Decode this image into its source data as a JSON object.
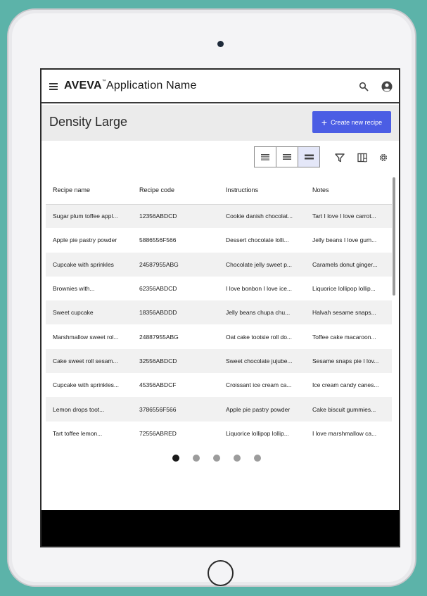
{
  "app": {
    "brand": "AVEVA",
    "trademark": "™",
    "name": "Application Name"
  },
  "page": {
    "title": "Density Large",
    "create_label": "Create new recipe"
  },
  "toolbar": {
    "density_options": [
      "compact-density-icon",
      "standard-density-icon",
      "large-density-icon"
    ],
    "selected_density": "large-density-icon",
    "tools": [
      "filter-icon",
      "columns-icon",
      "settings-icon"
    ]
  },
  "table": {
    "headers": [
      "Recipe name",
      "Recipe code",
      "Instructions",
      "Notes"
    ],
    "rows": [
      [
        "Sugar plum toffee appl...",
        "12356ABDCD",
        "Cookie danish chocolat...",
        "Tart I love I love carrot..."
      ],
      [
        "Apple pie pastry powder",
        "5886556F566",
        "Dessert chocolate lolli...",
        "Jelly beans I love gum..."
      ],
      [
        "Cupcake with sprinkles",
        "24587955ABG",
        "Chocolate jelly sweet p...",
        "Caramels donut ginger..."
      ],
      [
        "Brownies with...",
        "62356ABDCD",
        "I love bonbon I love ice...",
        "Liquorice lollipop lollip..."
      ],
      [
        "Sweet cupcake",
        "18356ABDDD",
        "Jelly beans chupa chu...",
        "Halvah sesame snaps..."
      ],
      [
        "Marshmallow sweet rol...",
        "24887955ABG",
        "Oat cake tootsie roll do...",
        "Toffee cake macaroon..."
      ],
      [
        "Cake sweet roll sesam...",
        "32556ABDCD",
        "Sweet chocolate jujube...",
        "Sesame snaps pie I lov..."
      ],
      [
        "Cupcake with sprinkles...",
        "45356ABDCF",
        "Croissant ice cream ca...",
        "Ice cream candy canes..."
      ],
      [
        "Lemon drops toot...",
        "3786556F566",
        "Apple pie pastry powder",
        "Cake biscuit gummies..."
      ],
      [
        "Tart toffee lemon...",
        "72556ABRED",
        "Liquorice lollipop lollip...",
        "I love marshmallow ca..."
      ]
    ]
  },
  "pagination": {
    "pages": 5,
    "current": 1
  },
  "colors": {
    "accent": "#4b5de4",
    "background": "#5cb3a9",
    "stripe": "#f1f1f1"
  }
}
